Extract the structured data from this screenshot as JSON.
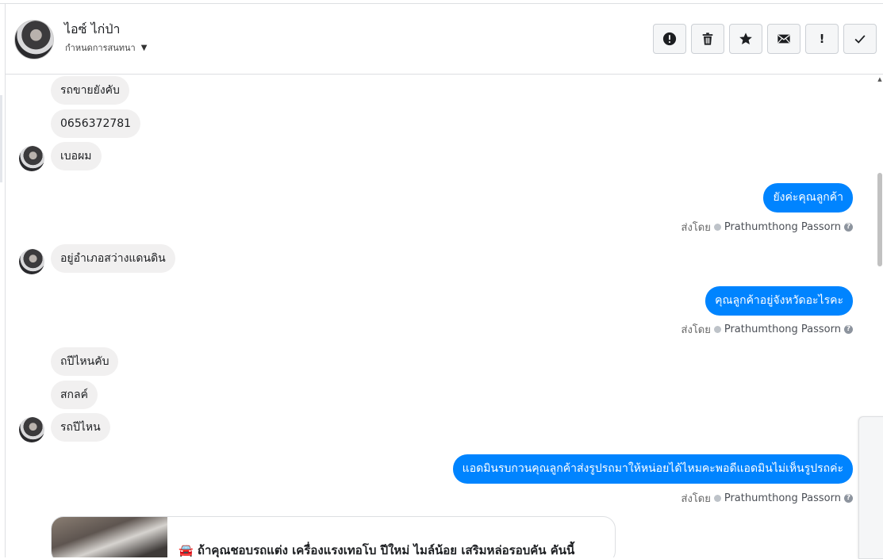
{
  "header": {
    "contact_name": "ไอซ์ ไก่ป่า",
    "subtitle": "กำหนดการสนทนา",
    "actions": [
      {
        "name": "spam-button",
        "icon": "alert-circle-icon"
      },
      {
        "name": "delete-button",
        "icon": "trash-icon"
      },
      {
        "name": "star-button",
        "icon": "star-icon"
      },
      {
        "name": "mark-unread-button",
        "icon": "envelope-icon",
        "label": ""
      },
      {
        "name": "follow-up-button",
        "icon": "exclamation-icon",
        "label": "!"
      },
      {
        "name": "mark-done-button",
        "icon": "check-icon"
      }
    ]
  },
  "messages": {
    "m1": "รถขายยังคับ",
    "m2": "0656372781",
    "m3": "เบอผม",
    "m4": "ยังค่ะคุณลูกค้า",
    "m5": "อยู่อำเภอสว่างแดนดิน",
    "m6": "คุณลูกค้าอยู่จังหวัดอะไรคะ",
    "m7": "ถปีไหนคับ",
    "m8": "สกลค์",
    "m9": "รถปีไหน",
    "m10": "แอดมินรบกวนคุณลูกค้าส่งรูปรถมาให้หน่อยได้ไหมคะพอดีแอดมินไม่เห็นรูปรถค่ะ"
  },
  "sent_by": {
    "prefix": "ส่งโดย",
    "agent": "Prathumthong Passorn",
    "help": "?"
  },
  "card": {
    "text": "🚘 ถ้าคุณชอบรถแต่ง เครื่องแรงเทอโบ ปีใหม่ ไมล์น้อย เสริมหล่อรอบคัน คันนี้"
  }
}
